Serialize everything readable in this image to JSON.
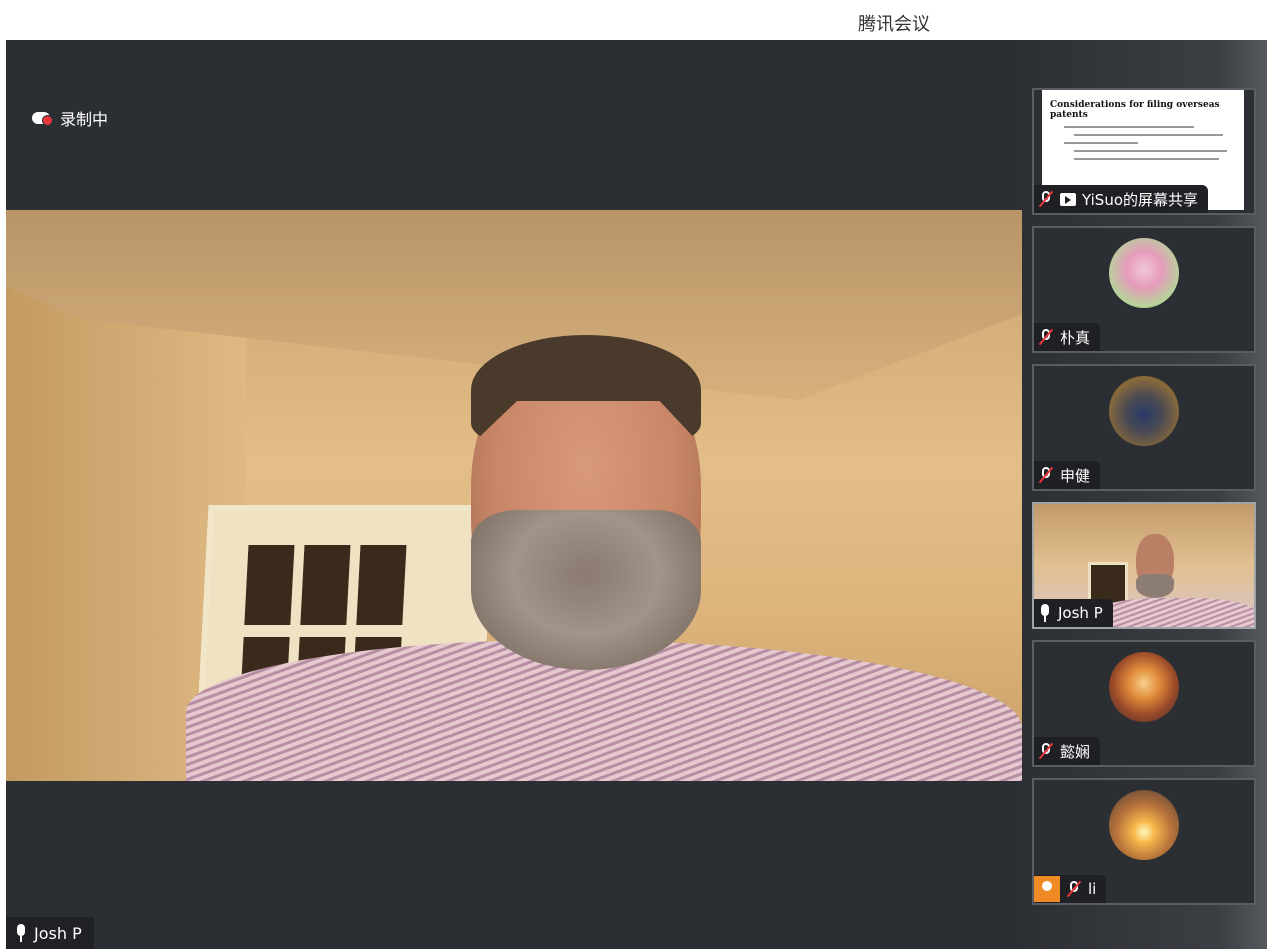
{
  "app": {
    "title": "腾讯会议"
  },
  "recording": {
    "label": "录制中"
  },
  "main_video": {
    "speaker_name": "Josh P"
  },
  "sidebar": {
    "tiles": [
      {
        "name": "YiSuo的屏幕共享",
        "type": "screen-share",
        "mic": "muted",
        "slide_title": "Considerations for filing overseas patents"
      },
      {
        "name": "朴真",
        "type": "avatar",
        "mic": "muted",
        "avatar": "lotus-flower"
      },
      {
        "name": "申健",
        "type": "avatar",
        "mic": "muted",
        "avatar": "man-in-suit"
      },
      {
        "name": "Josh P",
        "type": "video",
        "mic": "on",
        "active": true
      },
      {
        "name": "懿娴",
        "type": "avatar",
        "mic": "muted",
        "avatar": "sunset-clouds"
      },
      {
        "name": "li",
        "type": "avatar",
        "mic": "muted",
        "avatar": "sunset-mountains",
        "host_badge": true
      }
    ]
  },
  "colors": {
    "stage": "#2b2e33",
    "recording_dot": "#e8383d",
    "host_badge": "#f08a24"
  }
}
